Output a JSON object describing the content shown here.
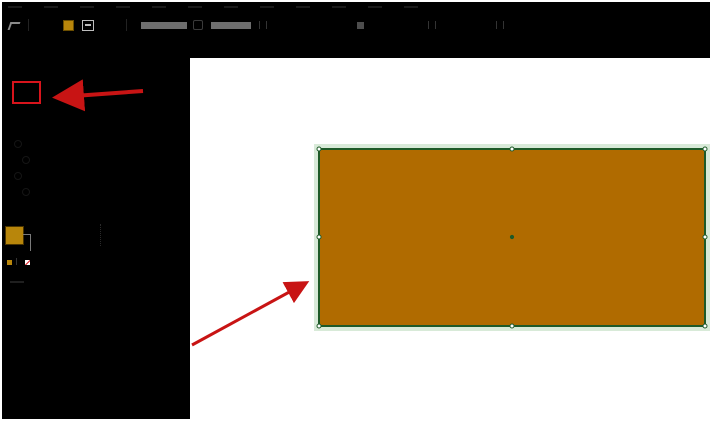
{
  "colors": {
    "window_background": "#000000",
    "canvas_background": "#ffffff",
    "shape_fill": "#b06b00",
    "shape_stroke": "#1e5a28",
    "handle_color": "#1e5a28",
    "annotation_red": "#c81414",
    "swatch_fill": "#b8860b"
  },
  "options_bar": {
    "tool_preset_icon": "selection-arrow-icon",
    "fill_swatch_icon": "fill-color-swatch-icon",
    "stroke_swatch_icon": "stroke-swatch-icon"
  },
  "left_panel": {
    "rectangle_tool_icon": "rectangle-tool-icon",
    "fill_stroke_icon": "fill-stroke-swatch-icon",
    "none_swatch_icon": "no-fill-swatch-icon"
  },
  "canvas": {
    "shape_icon": "rectangle-shape",
    "handle_icon": "selection-handle"
  },
  "annotations": {
    "arrow_to_tool": "red-arrow-icon",
    "arrow_to_shape": "red-arrow-icon"
  }
}
